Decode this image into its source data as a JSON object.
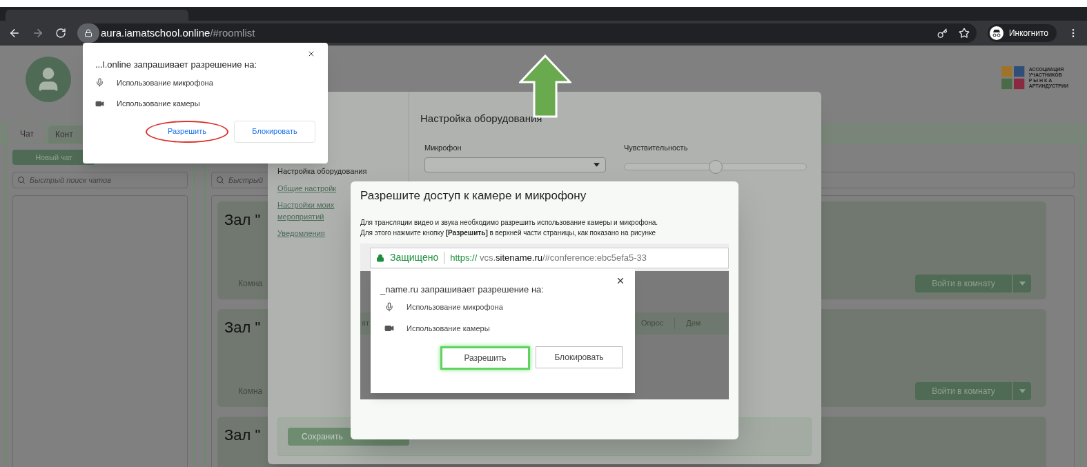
{
  "browser": {
    "url_host": "aura.iamatschool.online",
    "url_path": "/#roomlist",
    "profile": "Инкогнито"
  },
  "logo": {
    "lines": [
      "АССОЦИАЦИЯ",
      "УЧАСТНИКОВ",
      "Р Ы Н К А",
      "АРТИНДУСТРИИ"
    ]
  },
  "tabs": [
    {
      "label": "Чат",
      "selected": true
    },
    {
      "label": "Конт",
      "selected": false
    }
  ],
  "chat_panel": {
    "new_chat_button": "Новый чат",
    "search_placeholder": "Быстрый поиск чатов"
  },
  "rooms_panel": {
    "search_placeholder": "Быстрый",
    "rooms": [
      {
        "title": "Зал \"",
        "subtitle": "Комна",
        "button": "Войти в комнату"
      },
      {
        "title": "Зал \"",
        "subtitle": "Комна",
        "button": "Войти в комнату"
      },
      {
        "title": "Зал \""
      }
    ]
  },
  "settings_modal": {
    "nav": [
      {
        "label": "Настройка оборудования",
        "selected": true
      },
      {
        "label": "Общие настройк",
        "selected": false
      },
      {
        "label": "Настройки моих мероприятий",
        "selected": false
      },
      {
        "label": "Уведомления",
        "selected": false
      }
    ],
    "heading": "Настройка оборудования",
    "microphone_label": "Микрофон",
    "sensitivity_label": "Чувствительность",
    "sensitivity": {
      "level": 0.5
    },
    "save_button": "Сохранить"
  },
  "access_dialog": {
    "title": "Разрешите доступ к камере и микрофону",
    "paragraphs": [
      "Для трансляции видео и звука необходимо разрешить использование камеры и микрофона.",
      "Для этого нажмите кнопку **[Разрешить]** в верхней части страницы, как показано на рисунке"
    ],
    "illustration": {
      "secure_label": "Защищено",
      "url_scheme": "https://",
      "url_subdomain": " vcs.",
      "url_domain": "sitename.ru",
      "url_rest": "/#conference:ebc5efa5-33",
      "toolbar": [
        "ят",
        "Опрос",
        "Дем"
      ],
      "prompt": {
        "title": "_name.ru запрашивает разрешение на:",
        "items": [
          {
            "kind": "mic",
            "label": "Использование микрофона"
          },
          {
            "kind": "camera",
            "label": "Использование камеры"
          }
        ],
        "buttons": [
          {
            "label": "Разрешить",
            "highlighted": true
          },
          {
            "label": "Блокировать",
            "highlighted": false
          }
        ]
      }
    }
  },
  "permission_popup": {
    "title": "...l.online запрашивает разрешение на:",
    "items": [
      {
        "kind": "mic",
        "label": "Использование микрофона"
      },
      {
        "kind": "camera",
        "label": "Использование камеры"
      }
    ],
    "buttons": [
      {
        "label": "Разрешить",
        "highlighted": true
      },
      {
        "label": "Блокировать",
        "highlighted": false
      }
    ]
  }
}
